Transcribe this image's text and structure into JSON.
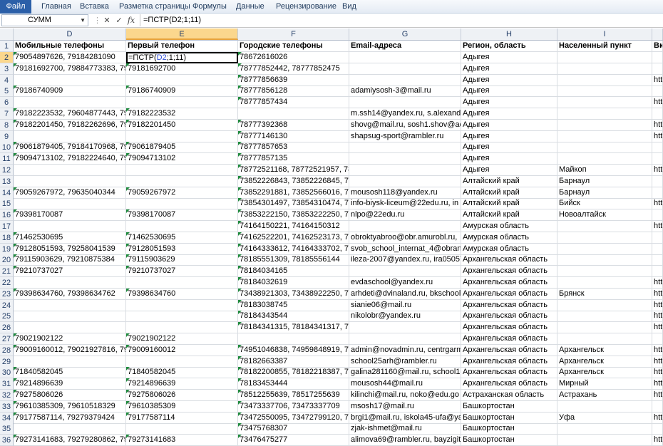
{
  "ribbon": {
    "tabs": [
      "Файл",
      "Главная",
      "Вставка",
      "Разметка страницы",
      "Формулы",
      "Данные",
      "Рецензирование",
      "Вид"
    ]
  },
  "formula_bar": {
    "name_box": "СУММ",
    "fx": "fx",
    "formula": "=ПСТР(D2;1;11)"
  },
  "columns": [
    "D",
    "E",
    "F",
    "G",
    "H",
    "I"
  ],
  "header_row": {
    "D": "Мобильные телефоны",
    "E": "Первый телефон",
    "F": "Городские телефоны",
    "G": "Email-адреса",
    "H": "Регион, область",
    "I": "Населенный пункт",
    "J": "Вк"
  },
  "active_cell": {
    "prefix": "=ПСТР(",
    "ref": "D2",
    "suffix": ";1;11)"
  },
  "rows": [
    {
      "n": "2",
      "D": "79054897626, 79184281090",
      "E": "",
      "F": "78672616026",
      "G": "",
      "H": "Адыгея",
      "I": "",
      "J": ""
    },
    {
      "n": "3",
      "D": "79181692700, 79884773383, 7988",
      "E": "79181692700",
      "F": "78777852442, 78777852475",
      "G": "",
      "H": "Адыгея",
      "I": "",
      "J": ""
    },
    {
      "n": "4",
      "D": "",
      "E": "",
      "F": "78777856639",
      "G": "",
      "H": "Адыгея",
      "I": "",
      "J": "htt"
    },
    {
      "n": "5",
      "D": "79186740909",
      "E": "79186740909",
      "F": "78777856128",
      "G": "adamiysosh-3@mail.ru",
      "H": "Адыгея",
      "I": "",
      "J": ""
    },
    {
      "n": "6",
      "D": "",
      "E": "",
      "F": "78777857434",
      "G": "",
      "H": "Адыгея",
      "I": "",
      "J": "htt"
    },
    {
      "n": "7",
      "D": "79182223532, 79604877443, 7961",
      "E": "79182223532",
      "F": "",
      "G": "m.ssh14@yandex.ru, s.alexandr",
      "H": "Адыгея",
      "I": "",
      "J": ""
    },
    {
      "n": "8",
      "D": "79182201450, 79182262696, 7918",
      "E": "79182201450",
      "F": "78777392368",
      "G": "shovg@mail.ru, sosh1.shov@ad",
      "H": "Адыгея",
      "I": "",
      "J": "htt"
    },
    {
      "n": "9",
      "D": "",
      "E": "",
      "F": "78777146130",
      "G": "shapsug-sport@rambler.ru",
      "H": "Адыгея",
      "I": "",
      "J": "htt"
    },
    {
      "n": "10",
      "D": "79061879405, 79184170968, 7962",
      "E": "79061879405",
      "F": "78777857653",
      "G": "",
      "H": "Адыгея",
      "I": "",
      "J": ""
    },
    {
      "n": "11",
      "D": "79094713102, 79182224640, 7918",
      "E": "79094713102",
      "F": "78777857135",
      "G": "",
      "H": "Адыгея",
      "I": "",
      "J": ""
    },
    {
      "n": "12",
      "D": "",
      "E": "",
      "F": "78772521168, 78772521957, 78772522002, 78772525153, 78772525",
      "G": "",
      "H": "Адыгея",
      "I": "Майкоп",
      "J": "htt"
    },
    {
      "n": "13",
      "D": "",
      "E": "",
      "F": "73852226843, 73852226845, 73852226850",
      "G": "",
      "H": "Алтайский край",
      "I": "Барнаул",
      "J": ""
    },
    {
      "n": "14",
      "D": "79059267972, 79635040344",
      "E": "79059267972",
      "F": "73852291881, 73852566016, 7385",
      "G": "mousosh118@yandex.ru",
      "H": "Алтайский край",
      "I": "Барнаул",
      "J": ""
    },
    {
      "n": "15",
      "D": "",
      "E": "",
      "F": "73854301497, 73854310474, 7385",
      "G": "info-biysk-liceum@22edu.ru, in",
      "H": "Алтайский край",
      "I": "Бийск",
      "J": "htt"
    },
    {
      "n": "16",
      "D": "79398170087",
      "E": "79398170087",
      "F": "73853222150, 73853222250, 7385",
      "G": "nlpo@22edu.ru",
      "H": "Алтайский край",
      "I": "Новоалтайск",
      "J": ""
    },
    {
      "n": "17",
      "D": "",
      "E": "",
      "F": "74164150221, 74164150312",
      "G": "",
      "H": "Амурская область",
      "I": "",
      "J": "htt"
    },
    {
      "n": "18",
      "D": "71462530695",
      "E": "71462530695",
      "F": "74162522201, 74162523173, 7416",
      "G": "obroktyabroo@obr.amurobl.ru,",
      "H": "Амурская область",
      "I": "",
      "J": ""
    },
    {
      "n": "19",
      "D": "79128051593, 79258041539",
      "E": "79128051593",
      "F": "74164333612, 74164333702, 7495",
      "G": "svob_school_internat_4@obran",
      "H": "Амурская область",
      "I": "",
      "J": ""
    },
    {
      "n": "20",
      "D": "79115903629, 79210875384",
      "E": "79115903629",
      "F": "78185551309, 78185556144",
      "G": "ileza-2007@yandex.ru, ira05057",
      "H": "Архангельская область",
      "I": "",
      "J": ""
    },
    {
      "n": "21",
      "D": "79210737027",
      "E": "79210737027",
      "F": "78184034165",
      "G": "",
      "H": "Архангельская область",
      "I": "",
      "J": ""
    },
    {
      "n": "22",
      "D": "",
      "E": "",
      "F": "78184032619",
      "G": "evdaschool@yandex.ru",
      "H": "Архангельская область",
      "I": "",
      "J": "htt"
    },
    {
      "n": "23",
      "D": "79398634760, 79398634762",
      "E": "79398634760",
      "F": "73438921303, 73438922250, 7343",
      "G": "arhdeti@dvinaland.ru, bkschool",
      "H": "Архангельская область",
      "I": "Брянск",
      "J": "htt"
    },
    {
      "n": "24",
      "D": "",
      "E": "",
      "F": "78183038745",
      "G": "sianie06@mail.ru",
      "H": "Архангельская область",
      "I": "",
      "J": "htt"
    },
    {
      "n": "25",
      "D": "",
      "E": "",
      "F": "78184343544",
      "G": "nikolobr@yandex.ru",
      "H": "Архангельская область",
      "I": "",
      "J": "htt"
    },
    {
      "n": "26",
      "D": "",
      "E": "",
      "F": "78184341315, 78184341317, 78184341335, 78184342039",
      "G": "",
      "H": "Архангельская область",
      "I": "",
      "J": "htt"
    },
    {
      "n": "27",
      "D": "79021902122",
      "E": "79021902122",
      "F": "",
      "G": "",
      "H": "Архангельская область",
      "I": "",
      "J": ""
    },
    {
      "n": "28",
      "D": "79009160012, 79021927816, 7902",
      "E": "79009160012",
      "F": "74951046838, 74959848919, 7818",
      "G": "admin@novadmin.ru, centrgarm",
      "H": "Архангельская область",
      "I": "Архангельск",
      "J": "htt"
    },
    {
      "n": "29",
      "D": "",
      "E": "",
      "F": "78182663387",
      "G": "school25arh@rambler.ru",
      "H": "Архангельская область",
      "I": "Архангельск",
      "J": "htt"
    },
    {
      "n": "30",
      "D": "71840582045",
      "E": "71840582045",
      "F": "78182200855, 78182218387, 7818",
      "G": "galina281160@mail.ru, school1",
      "H": "Архангельская область",
      "I": "Архангельск",
      "J": "htt"
    },
    {
      "n": "31",
      "D": "79214896639",
      "E": "79214896639",
      "F": "78183453444",
      "G": "mousosh44@mail.ru",
      "H": "Архангельская область",
      "I": "Мирный",
      "J": "htt"
    },
    {
      "n": "32",
      "D": "79275806026",
      "E": "79275806026",
      "F": "78512255639, 78517255639",
      "G": "kilinchi@mail.ru, noko@edu.go",
      "H": "Астраханская область",
      "I": "Астрахань",
      "J": "htt"
    },
    {
      "n": "33",
      "D": "79610385309, 79610518329",
      "E": "79610385309",
      "F": "73473337706, 73473337709",
      "G": "msosh17@mail.ru",
      "H": "Башкортостан",
      "I": "",
      "J": ""
    },
    {
      "n": "34",
      "D": "79177587114, 79279379424",
      "E": "79177587114",
      "F": "73472550095, 73472799120, 7347",
      "G": "brgi1@mail.ru, iskola45-ufa@ya",
      "H": "Башкортостан",
      "I": "Уфа",
      "J": "htt"
    },
    {
      "n": "35",
      "D": "",
      "E": "",
      "F": "73475768307",
      "G": "zjak-ishmet@mail.ru",
      "H": "Башкортостан",
      "I": "",
      "J": ""
    },
    {
      "n": "36",
      "D": "79273141683, 79279280862, 7927",
      "E": "79273141683",
      "F": "73476475277",
      "G": "alimova69@rambler.ru, bayzigit",
      "H": "Башкортостан",
      "I": "",
      "J": "htt"
    }
  ]
}
